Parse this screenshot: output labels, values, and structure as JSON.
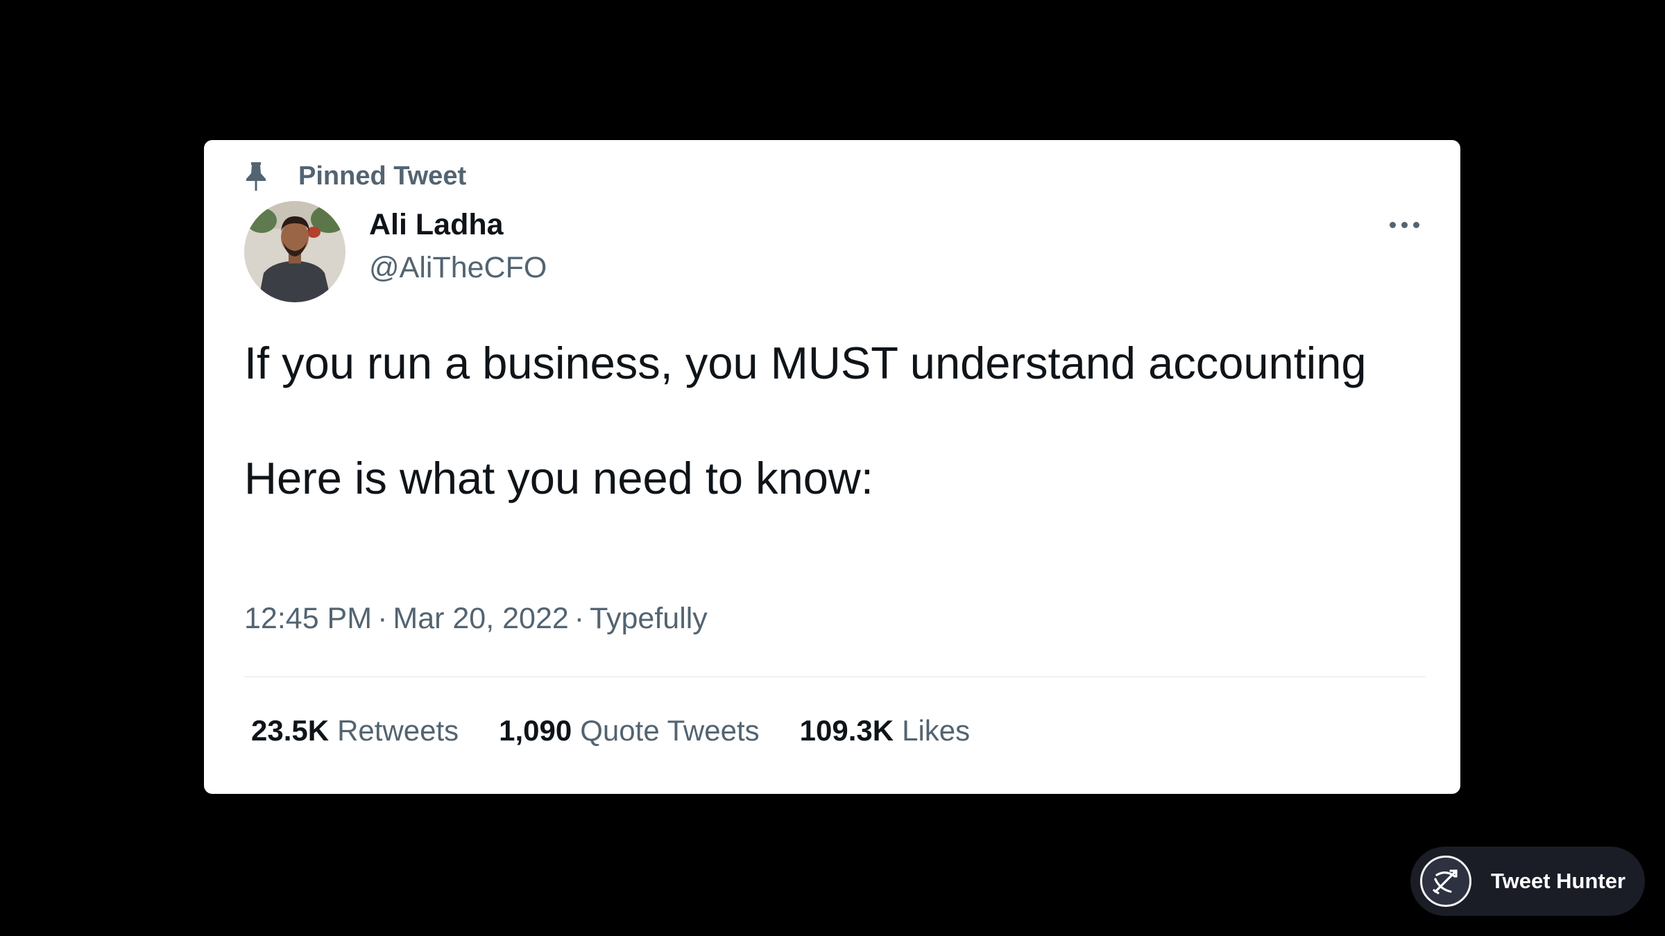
{
  "tweet": {
    "pinned_label": "Pinned Tweet",
    "author": {
      "name": "Ali Ladha",
      "handle": "@AliTheCFO"
    },
    "text": {
      "paragraph_1": "If you run a business, you MUST understand accounting",
      "paragraph_2": "Here is what you need to know:"
    },
    "meta": {
      "time": "12:45 PM",
      "separator": "·",
      "date": "Mar 20, 2022",
      "source": "Typefully"
    },
    "stats": [
      {
        "value": "23.5K",
        "label": "Retweets"
      },
      {
        "value": "1,090",
        "label": "Quote Tweets"
      },
      {
        "value": "109.3K",
        "label": "Likes"
      }
    ],
    "icons": {
      "pin": "pin-icon",
      "more": "more-icon"
    }
  },
  "watermark": {
    "label": "Tweet Hunter",
    "icon": "tweet-hunter-logo-icon"
  },
  "colors": {
    "background": "#000000",
    "card": "#ffffff",
    "text_primary": "#0f1419",
    "text_secondary": "#536471",
    "badge_bg": "#1a1d26"
  }
}
